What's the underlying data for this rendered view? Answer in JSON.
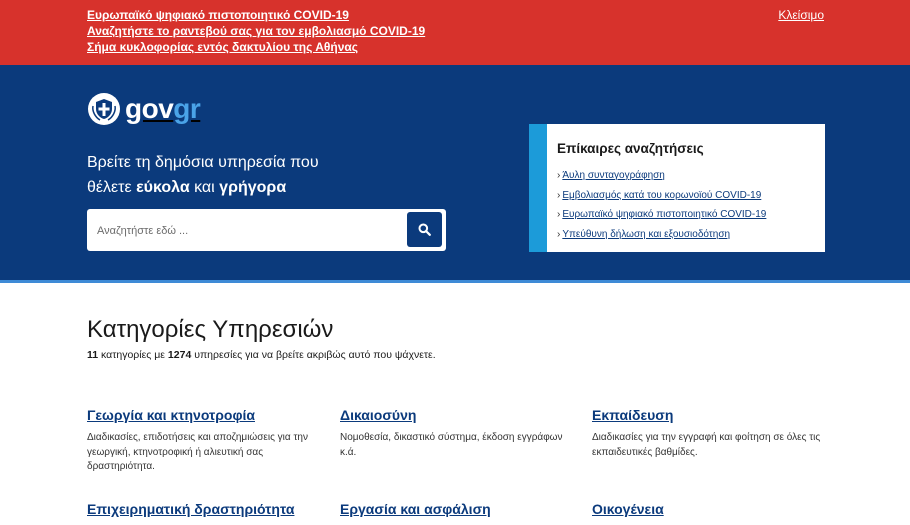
{
  "alert": {
    "links": [
      "Ευρωπαϊκό ψηφιακό πιστοποιητικό COVID-19",
      "Αναζητήστε το ραντεβού σας για τον εμβολιασμό COVID-19",
      "Σήμα κυκλοφορίας εντός δακτυλίου της Αθήνας"
    ],
    "close_label": "Κλείσιμο"
  },
  "logo": {
    "part1": "gov",
    "part2": "gr",
    "emblem_icon": "greek-coat-of-arms-icon"
  },
  "hero": {
    "title_line1": "Βρείτε τη δημόσια υπηρεσία που",
    "title_line2_prefix": "θέλετε ",
    "title_line2_bold1": "εύκολα",
    "title_line2_mid": " και ",
    "title_line2_bold2": "γρήγορα"
  },
  "search": {
    "placeholder": "Αναζητήστε εδώ ...",
    "button_icon": "search-icon"
  },
  "trending": {
    "title": "Επίκαιρες αναζητήσεις",
    "items": [
      "Άυλη συνταγογράφηση",
      "Εμβολιασμός κατά του κορωνοϊού COVID-19",
      "Ευρωπαϊκό ψηφιακό πιστοποιητικό COVID-19",
      "Υπεύθυνη δήλωση και εξουσιοδότηση"
    ]
  },
  "categories": {
    "heading": "Κατηγορίες Υπηρεσιών",
    "summary_count": "11",
    "summary_text1": " κατηγορίες με ",
    "summary_services": "1274",
    "summary_text2": " υπηρεσίες για να βρείτε ακριβώς αυτό που ψάχνετε.",
    "items": [
      {
        "title": "Γεωργία και κτηνοτροφία",
        "description": "Διαδικασίες, επιδοτήσεις και αποζημιώσεις για την γεωργική, κτηνοτροφική ή αλιευτική σας δραστηριότητα."
      },
      {
        "title": "Δικαιοσύνη",
        "description": "Νομοθεσία, δικαστικό σύστημα, έκδοση εγγράφων κ.ά."
      },
      {
        "title": "Εκπαίδευση",
        "description": "Διαδικασίες για την εγγραφή και φοίτηση σε όλες τις εκπαιδευτικές βαθμίδες."
      },
      {
        "title": "Επιχειρηματική δραστηριότητα",
        "description": ""
      },
      {
        "title": "Εργασία και ασφάλιση",
        "description": ""
      },
      {
        "title": "Οικογένεια",
        "description": ""
      }
    ]
  },
  "colors": {
    "alert_bg": "#d7322c",
    "hero_bg": "#0b3a7c",
    "accent": "#1c9bd9"
  }
}
